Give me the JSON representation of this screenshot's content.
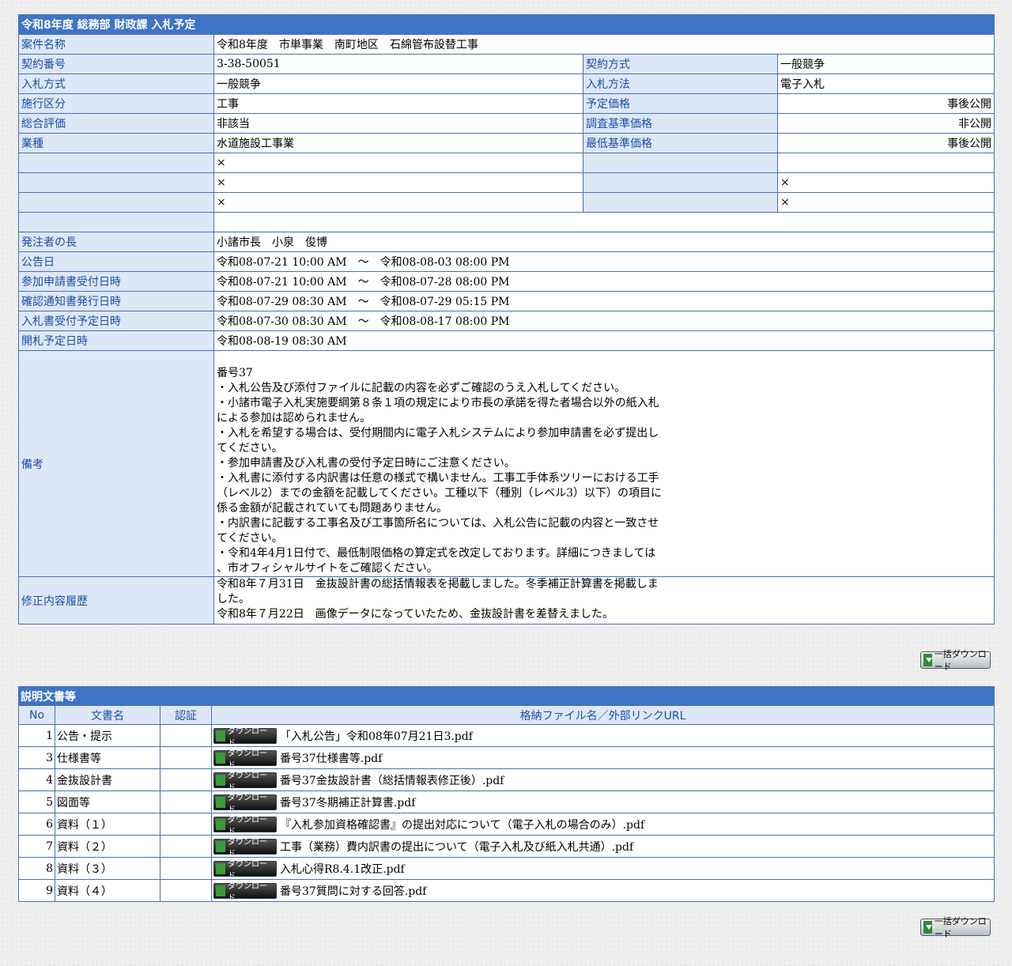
{
  "header": {
    "title": "令和8年度 総務部 財政課 入札予定"
  },
  "fields": {
    "anken_label": "案件名称",
    "anken_value": "令和8年度　市単事業　南町地区　石綿管布設替工事",
    "keiyaku_no_label": "契約番号",
    "keiyaku_no_value": "3-38-50051",
    "keiyaku_hoshiki_label": "契約方式",
    "keiyaku_hoshiki_value": "一般競争",
    "nyusatsu_hoshiki_label": "入札方式",
    "nyusatsu_hoshiki_value": "一般競争",
    "nyusatsu_hoho_label": "入札方法",
    "nyusatsu_hoho_value": "電子入札",
    "seko_label": "施行区分",
    "seko_value": "工事",
    "yotei_kakaku_label": "予定価格",
    "yotei_kakaku_value": "事後公開",
    "sogo_label": "総合評価",
    "sogo_value": "非該当",
    "chosa_label": "調査基準価格",
    "chosa_value": "非公開",
    "gyoshu_label": "業種",
    "gyoshu_value": "水道施設工事業",
    "saitei_label": "最低基準価格",
    "saitei_value": "事後公開",
    "blank_mark": "×",
    "hacchusha_label": "発注者の長",
    "hacchusha_value": "小諸市長　小泉　俊博",
    "kokoku_label": "公告日",
    "kokoku_value": "令和08-07-21 10:00 AM　～　令和08-08-03 08:00 PM",
    "sanka_label": "参加申請書受付日時",
    "sanka_value": "令和08-07-21 10:00 AM　～　令和08-07-28 08:00 PM",
    "kakunin_label": "確認通知書発行日時",
    "kakunin_value": "令和08-07-29 08:30 AM　～　令和08-07-29 05:15 PM",
    "uketsuke_label": "入札書受付予定日時",
    "uketsuke_value": "令和08-07-30 08:30 AM　～　令和08-08-17 08:00 PM",
    "kaisatsu_label": "開札予定日時",
    "kaisatsu_value": "令和08-08-19 08:30 AM",
    "biko_label": "備考",
    "biko_value": "\n番号37\n・入札公告及び添付ファイルに記載の内容を必ずご確認のうえ入札してください。\n・小諸市電子入札実施要綱第８条１項の規定により市長の承諾を得た者場合以外の紙入札\nによる参加は認められません。\n・入札を希望する場合は、受付期間内に電子入札システムにより参加申請書を必ず提出し\nてください。\n・参加申請書及び入札書の受付予定日時にご注意ください。\n・入札書に添付する内訳書は任意の様式で構いません。工事工手体系ツリーにおける工手\n（レベル2）までの金額を記載してください。工種以下（種別（レベル3）以下）の項目に\n係る金額が記載されていても問題ありません。\n・内訳書に記載する工事名及び工事箇所名については、入札公告に記載の内容と一致させ\nてください。\n・令和4年4月1日付で、最低制限価格の算定式を改定しております。詳細につきましては\n、市オフィシャルサイトをご確認ください。",
    "rireki_label": "修正内容履歴",
    "rireki_value": "令和8年７月31日　金抜設計書の総括情報表を掲載しました。冬季補正計算書を掲載しま\nした。\n令和8年７月22日　画像データになっていたため、金抜設計書を差替えました。"
  },
  "bulk_download_label": "一括ダウンロード",
  "docs": {
    "title": "説明文書等",
    "col_no": "No",
    "col_name": "文書名",
    "col_cert": "認証",
    "col_file": "格納ファイル名／外部リンクURL",
    "download_label": "ダウンロード",
    "rows": [
      {
        "no": "1",
        "name": "公告・提示",
        "file": "「入札公告」令和08年07月21日3.pdf"
      },
      {
        "no": "3",
        "name": "仕様書等",
        "file": "番号37仕様書等.pdf"
      },
      {
        "no": "4",
        "name": "金抜設計書",
        "file": "番号37金抜設計書（総括情報表修正後）.pdf"
      },
      {
        "no": "5",
        "name": "図面等",
        "file": "番号37冬期補正計算書.pdf"
      },
      {
        "no": "6",
        "name": "資料（１）",
        "file": "『入札参加資格確認書』の提出対応について（電子入札の場合のみ）.pdf"
      },
      {
        "no": "7",
        "name": "資料（２）",
        "file": "工事（業務）費内訳書の提出について（電子入札及び紙入札共通）.pdf"
      },
      {
        "no": "8",
        "name": "資料（３）",
        "file": "入札心得R8.4.1改正.pdf"
      },
      {
        "no": "9",
        "name": "資料（４）",
        "file": "番号37質問に対する回答.pdf"
      }
    ]
  }
}
